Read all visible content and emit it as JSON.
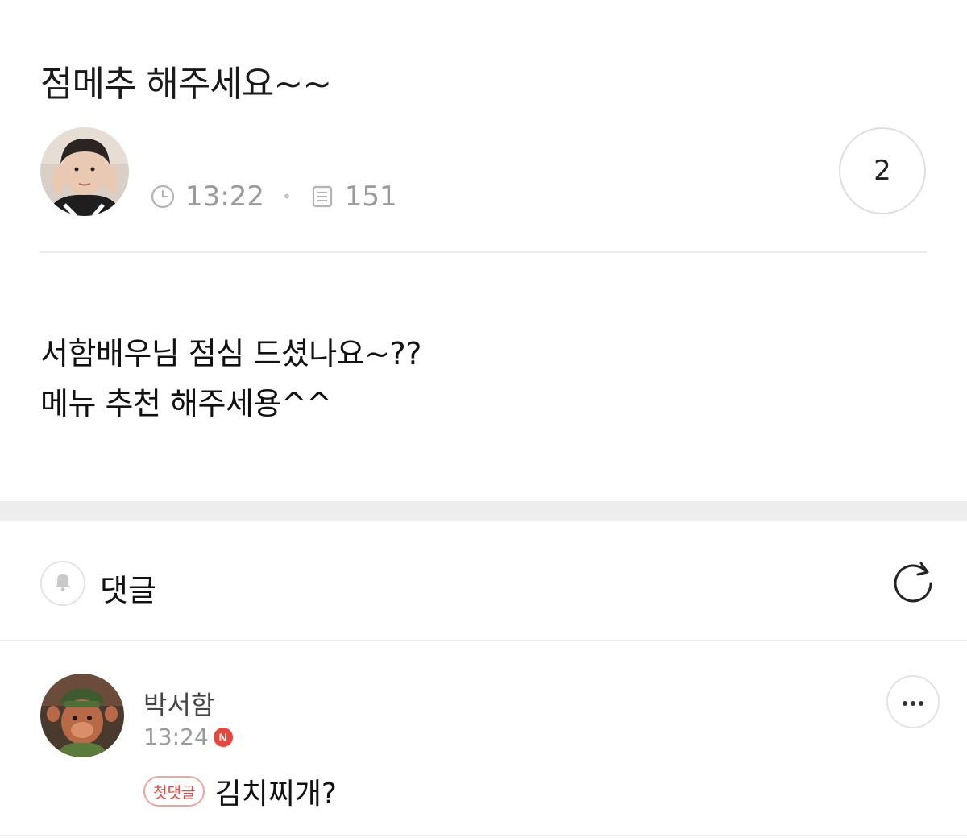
{
  "post": {
    "title": "점메추 해주세요~~",
    "author": {
      "name": "",
      "avatar": "author-photo"
    },
    "time": "13:22",
    "views": "151",
    "comment_count": "2",
    "body_lines": [
      "서함배우님 점심 드셨나요~??",
      "메뉴 추천 해주세용^^"
    ]
  },
  "comments_section": {
    "label": "댓글",
    "icons": {
      "bell": "bell-icon",
      "refresh": "refresh-icon"
    }
  },
  "comments": [
    {
      "author": "박서함",
      "time": "13:24",
      "new_badge": "N",
      "first_badge": "첫댓글",
      "text": "김치찌개?"
    }
  ],
  "colors": {
    "accent_red": "#e8473d",
    "meta_gray": "#9a9a9a",
    "divider": "#ebebeb"
  }
}
